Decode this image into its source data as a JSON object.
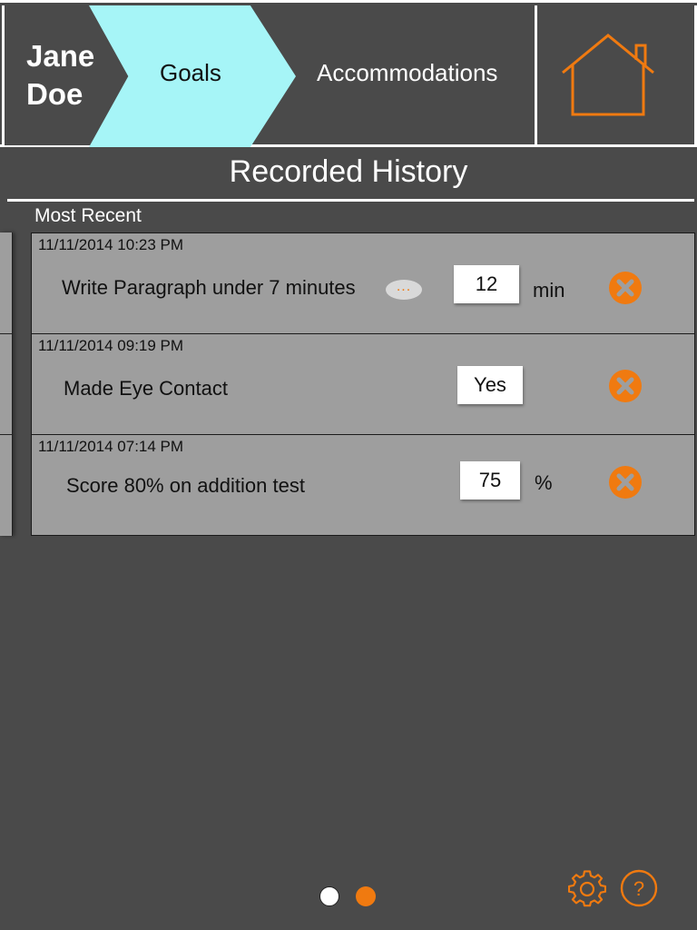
{
  "header": {
    "student_first": "Jane",
    "student_last": "Doe",
    "tabs": [
      {
        "label": "Goals"
      },
      {
        "label": "Accommodations"
      }
    ],
    "home_icon": "home-icon"
  },
  "main": {
    "title": "Recorded History",
    "section_label": "Most Recent",
    "entries": [
      {
        "timestamp": "11/11/2014 10:23 PM",
        "goal": "Write Paragraph under 7 minutes",
        "more": "...",
        "value": "12",
        "unit": "min"
      },
      {
        "timestamp": "11/11/2014 09:19 PM",
        "goal": "Made Eye Contact",
        "value": "Yes",
        "unit": ""
      },
      {
        "timestamp": "11/11/2014 07:14 PM",
        "goal": "Score 80% on addition test",
        "value": "75",
        "unit": "%"
      }
    ]
  },
  "footer": {
    "page_count": 2,
    "active_page": 2,
    "settings_icon": "gear-icon",
    "help_icon": "help-icon"
  },
  "colors": {
    "background": "#4a4a4a",
    "accent": "#f07a10",
    "active_tab": "#a6f5f7",
    "row_background": "#9e9e9e"
  }
}
